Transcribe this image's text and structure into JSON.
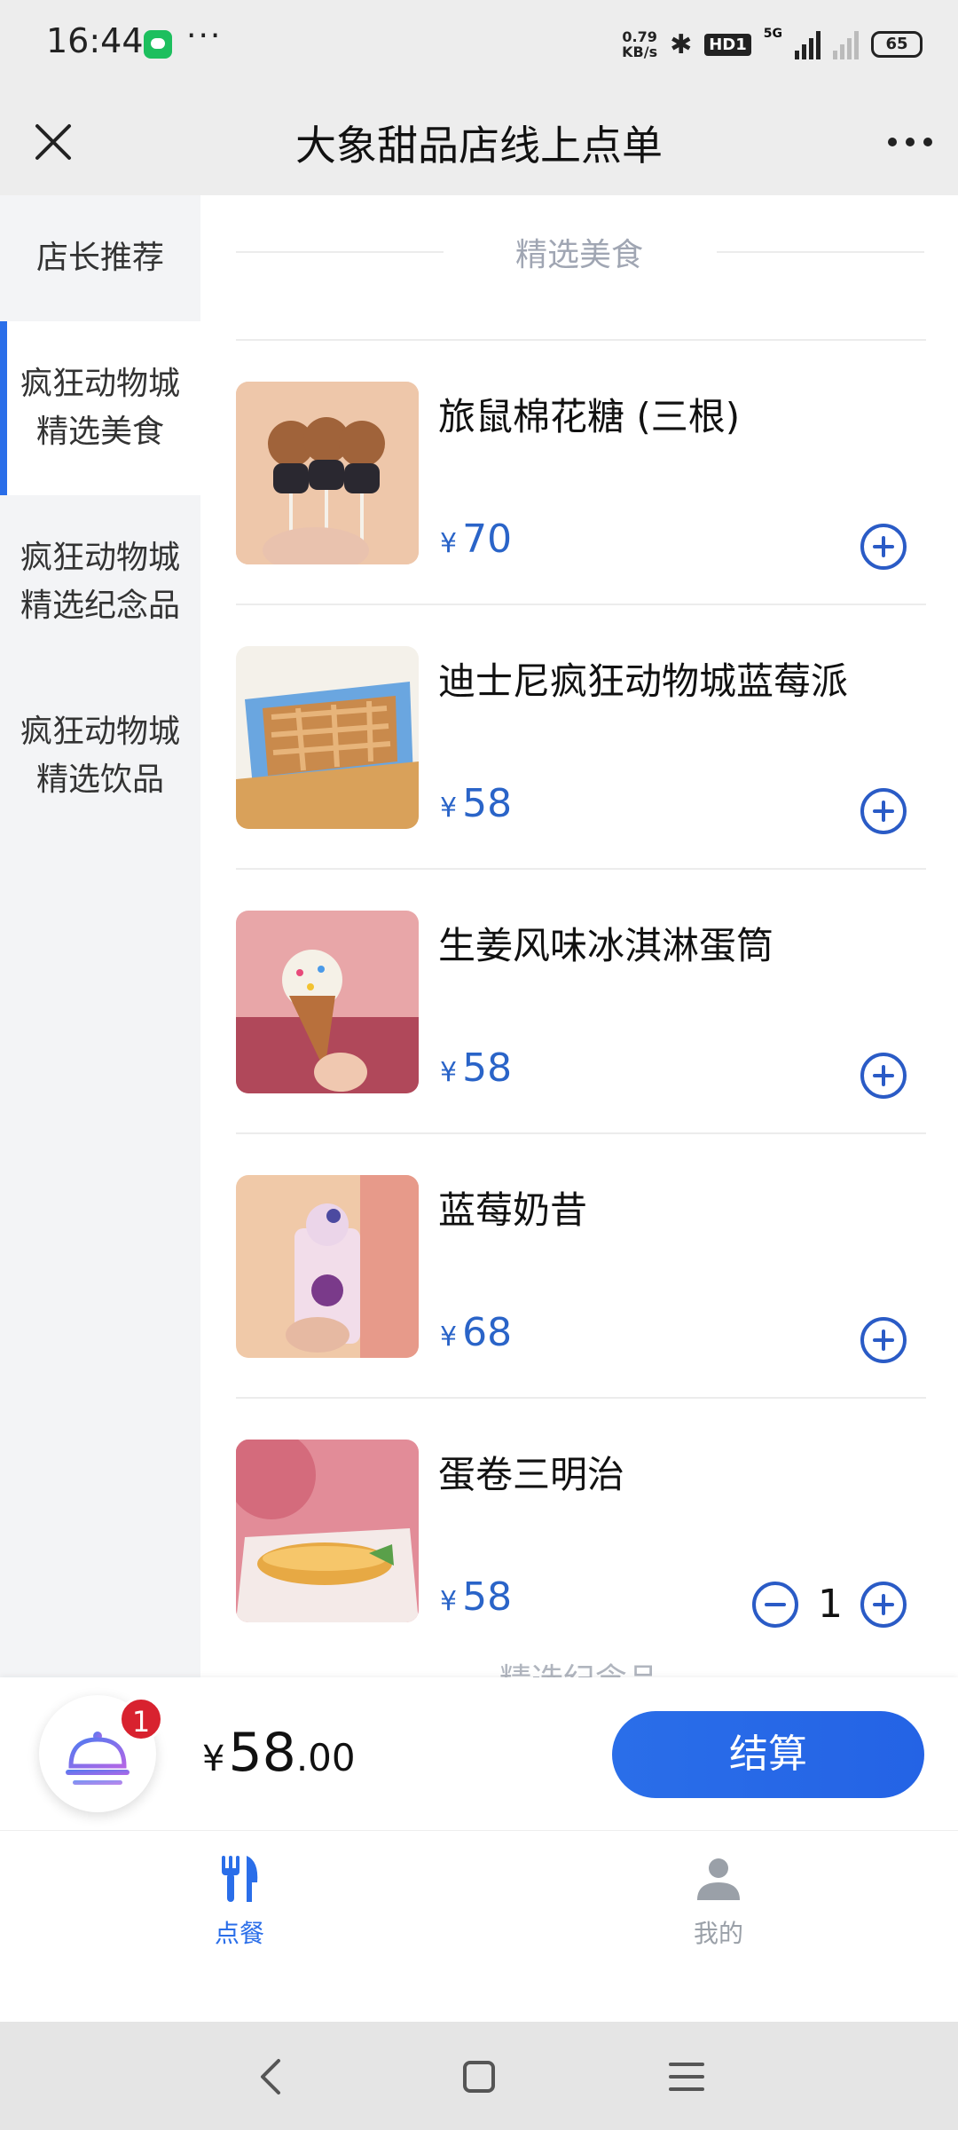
{
  "status_bar": {
    "time": "16:44",
    "more": "···",
    "speed_value": "0.79",
    "speed_unit": "KB/s",
    "bluetooth": "✱",
    "hd": "HD1",
    "network": "5G",
    "battery": "65"
  },
  "header": {
    "title": "大象甜品店线上点单"
  },
  "sidebar": {
    "items": [
      {
        "label": "店长推荐"
      },
      {
        "label": "疯狂动物城精选美食"
      },
      {
        "label": "疯狂动物城精选纪念品"
      },
      {
        "label": "疯狂动物城精选饮品"
      }
    ]
  },
  "section": {
    "title": "精选美食",
    "next_title": "精选纪念品"
  },
  "products": [
    {
      "name": "旅鼠棉花糖 (三根)",
      "currency": "¥",
      "price": "70"
    },
    {
      "name": "迪士尼疯狂动物城蓝莓派",
      "currency": "¥",
      "price": "58"
    },
    {
      "name": "生姜风味冰淇淋蛋筒",
      "currency": "¥",
      "price": "58"
    },
    {
      "name": "蓝莓奶昔",
      "currency": "¥",
      "price": "68"
    },
    {
      "name": "蛋卷三明治",
      "currency": "¥",
      "price": "58",
      "quantity": "1"
    }
  ],
  "cart": {
    "badge": "1",
    "currency": "¥",
    "total_int": "58",
    "total_dec": ".00",
    "checkout_label": "结算"
  },
  "tabs": {
    "order": "点餐",
    "mine": "我的"
  },
  "colors": {
    "accent": "#2a6ee9",
    "price": "#2a64c8",
    "badge": "#d8222f"
  }
}
